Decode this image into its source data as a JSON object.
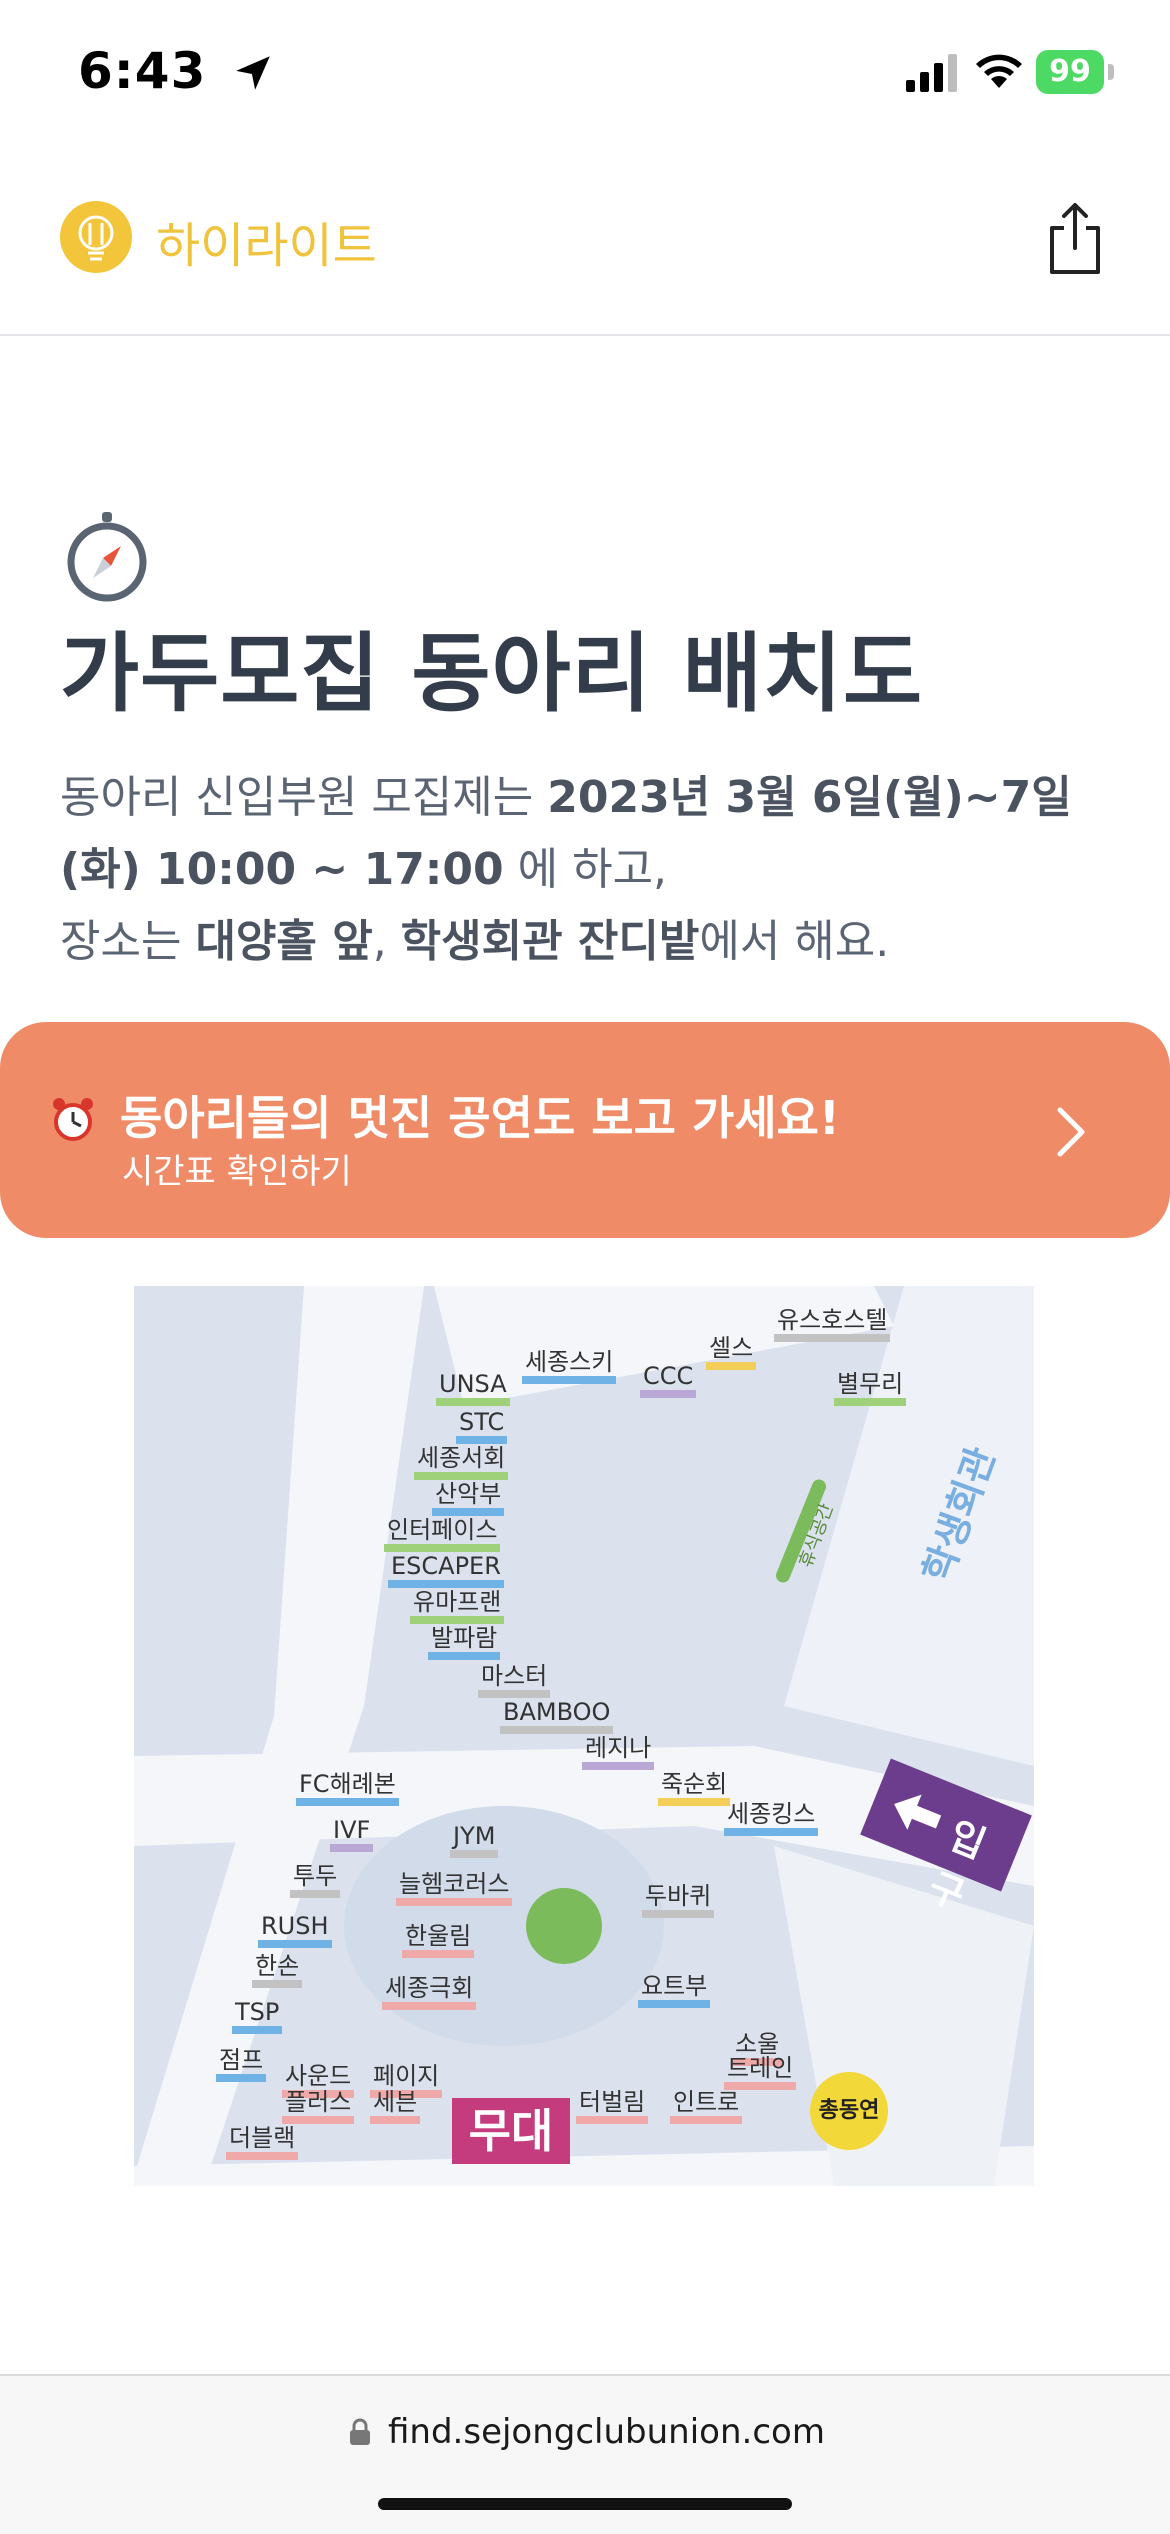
{
  "status_bar": {
    "time": "6:43",
    "battery": "99"
  },
  "header": {
    "brand": "하이라이트"
  },
  "hero": {
    "title": "가두모집 동아리 배치도",
    "line1_prefix": "동아리 신입부원 모집제는 ",
    "line1_bold": "2023년 3월 6일(월)~7일",
    "line2_bold": "(화) 10:00 ~ 17:00",
    "line2_suffix": " 에 하고,",
    "line3_prefix": "장소는 ",
    "line3_bold1": "대양홀 앞",
    "line3_sep": ", ",
    "line3_bold2": "학생회관 잔디밭",
    "line3_suffix": "에서 해요."
  },
  "banner": {
    "title": "동아리들의 멋진 공연도 보고 가세요!",
    "subtitle": "시간표 확인하기"
  },
  "map": {
    "building": "학생회관",
    "rest_area": "휴식공간",
    "stage": "무대",
    "entrance": "입구",
    "union": "총동연",
    "clubs": [
      {
        "name": "유스호스텔",
        "color": "gray"
      },
      {
        "name": "셀스",
        "color": "yellow"
      },
      {
        "name": "세종스키",
        "color": "blue"
      },
      {
        "name": "CCC",
        "color": "purple"
      },
      {
        "name": "UNSA",
        "color": "green"
      },
      {
        "name": "별무리",
        "color": "green"
      },
      {
        "name": "STC",
        "color": "blue"
      },
      {
        "name": "세종서회",
        "color": "green"
      },
      {
        "name": "산악부",
        "color": "blue"
      },
      {
        "name": "인터페이스",
        "color": "green"
      },
      {
        "name": "ESCAPER",
        "color": "blue"
      },
      {
        "name": "유마프랜",
        "color": "green"
      },
      {
        "name": "발파람",
        "color": "blue"
      },
      {
        "name": "마스터",
        "color": "gray"
      },
      {
        "name": "BAMBOO",
        "color": "gray"
      },
      {
        "name": "레지나",
        "color": "purple"
      },
      {
        "name": "죽순회",
        "color": "yellow"
      },
      {
        "name": "세종킹스",
        "color": "blue"
      },
      {
        "name": "FC해례본",
        "color": "blue"
      },
      {
        "name": "IVF",
        "color": "purple"
      },
      {
        "name": "JYM",
        "color": "gray"
      },
      {
        "name": "투두",
        "color": "gray"
      },
      {
        "name": "늘헴코러스",
        "color": "pink"
      },
      {
        "name": "두바퀴",
        "color": "gray"
      },
      {
        "name": "RUSH",
        "color": "blue"
      },
      {
        "name": "한울림",
        "color": "pink"
      },
      {
        "name": "한손",
        "color": "gray"
      },
      {
        "name": "세종극회",
        "color": "pink"
      },
      {
        "name": "요트부",
        "color": "blue"
      },
      {
        "name": "TSP",
        "color": "blue"
      },
      {
        "name": "점프",
        "color": "blue"
      },
      {
        "name": "사운드",
        "color": "pink"
      },
      {
        "name": "플러스",
        "color": "pink"
      },
      {
        "name": "페이지",
        "color": "pink"
      },
      {
        "name": "세븐",
        "color": "pink"
      },
      {
        "name": "소울",
        "color": "pink"
      },
      {
        "name": "트레인",
        "color": "pink"
      },
      {
        "name": "터벌림",
        "color": "pink"
      },
      {
        "name": "인트로",
        "color": "pink"
      },
      {
        "name": "더블랙",
        "color": "pink"
      }
    ]
  },
  "address_bar": {
    "url": "find.sejongclubunion.com"
  },
  "colors": {
    "accent": "#f0c33c",
    "banner": "#f08b67",
    "title": "#333c4a"
  }
}
